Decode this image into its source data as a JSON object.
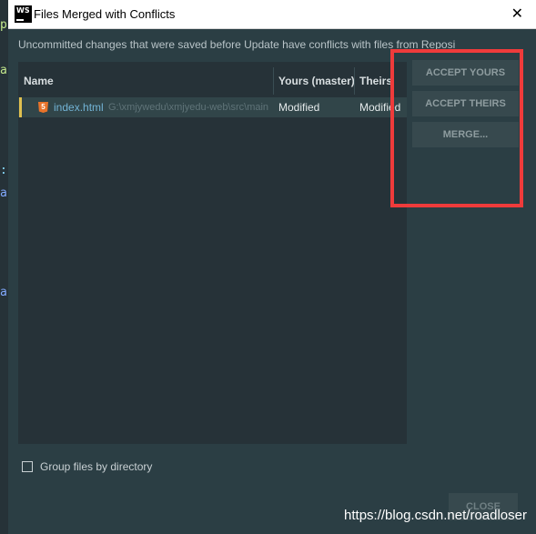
{
  "window": {
    "app_icon_label": "WS",
    "title": "Files Merged with Conflicts",
    "close_glyph": "✕"
  },
  "message": "Uncommitted changes that were saved before Update have conflicts with files from Repository",
  "table": {
    "columns": {
      "name": "Name",
      "yours": "Yours (master)",
      "theirs": "Theirs"
    },
    "rows": [
      {
        "icon": "html5-icon",
        "icon_glyph": "5",
        "file": "index.html",
        "path": "G:\\xmjywedu\\xmjyedu-web\\src\\main",
        "yours": "Modified",
        "theirs": "Modified"
      }
    ]
  },
  "actions": {
    "accept_yours": "ACCEPT YOURS",
    "accept_theirs": "ACCEPT THEIRS",
    "merge": "MERGE..."
  },
  "group_by_directory": {
    "label": "Group files by directory",
    "checked": false
  },
  "close_button": "CLOSE",
  "watermark": "https://blog.csdn.net/roadloser",
  "colors": {
    "dialog_bg": "#2b3e44",
    "highlight_border": "#ef3b3b",
    "file_name": "#72b3d5"
  }
}
